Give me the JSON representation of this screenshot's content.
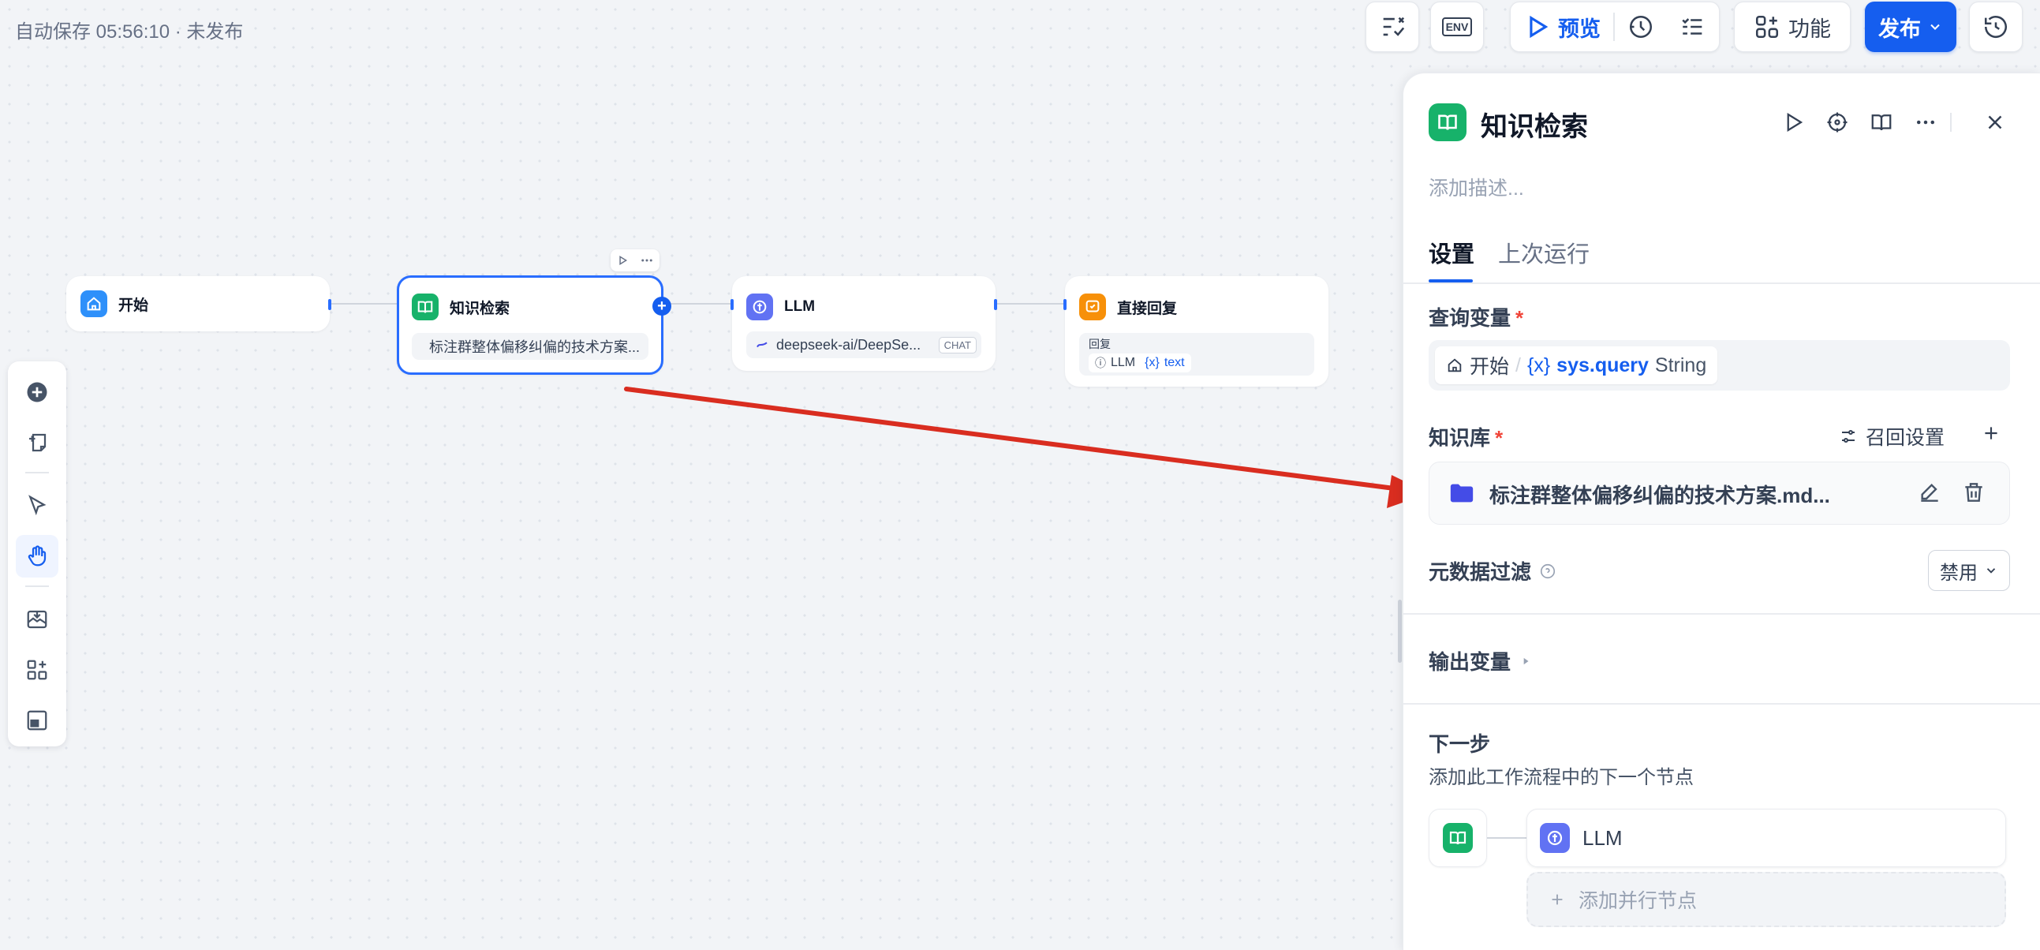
{
  "status": {
    "autosave": "自动保存 05:56:10 · 未发布"
  },
  "toolbar": {
    "preview_label": "预览",
    "features_label": "功能",
    "publish_label": "发布",
    "env_label": "ENV"
  },
  "nodes": {
    "start": {
      "title": "开始"
    },
    "knowledge": {
      "title": "知识检索",
      "dataset": "标注群整体偏移纠偏的技术方案..."
    },
    "llm": {
      "title": "LLM",
      "model": "deepseek-ai/DeepSe...",
      "mode_badge": "CHAT"
    },
    "answer": {
      "title": "直接回复",
      "body_label": "回复",
      "ref_node": "LLM",
      "ref_var": "text"
    }
  },
  "panel": {
    "title": "知识检索",
    "description_placeholder": "添加描述...",
    "tabs": [
      "设置",
      "上次运行"
    ],
    "query_var_label": "查询变量",
    "query_var": {
      "node": "开始",
      "sep": "/",
      "var": "sys.query",
      "type": "String"
    },
    "kb_label": "知识库",
    "recall_settings_label": "召回设置",
    "kb_item": "标注群整体偏移纠偏的技术方案.md...",
    "metadata_filter_label": "元数据过滤",
    "metadata_filter_value": "禁用",
    "output_vars_label": "输出变量",
    "next_step_label": "下一步",
    "next_step_desc": "添加此工作流程中的下一个节点",
    "next_node": "LLM",
    "add_parallel_label": "添加并行节点",
    "required_mark": "*"
  },
  "colors": {
    "accent": "#155eef",
    "knowledge_green": "#17b26a",
    "llm_indigo": "#6172f3",
    "answer_orange": "#f79009",
    "start_blue": "#2e90fa",
    "arrow_red": "#d92d20"
  }
}
